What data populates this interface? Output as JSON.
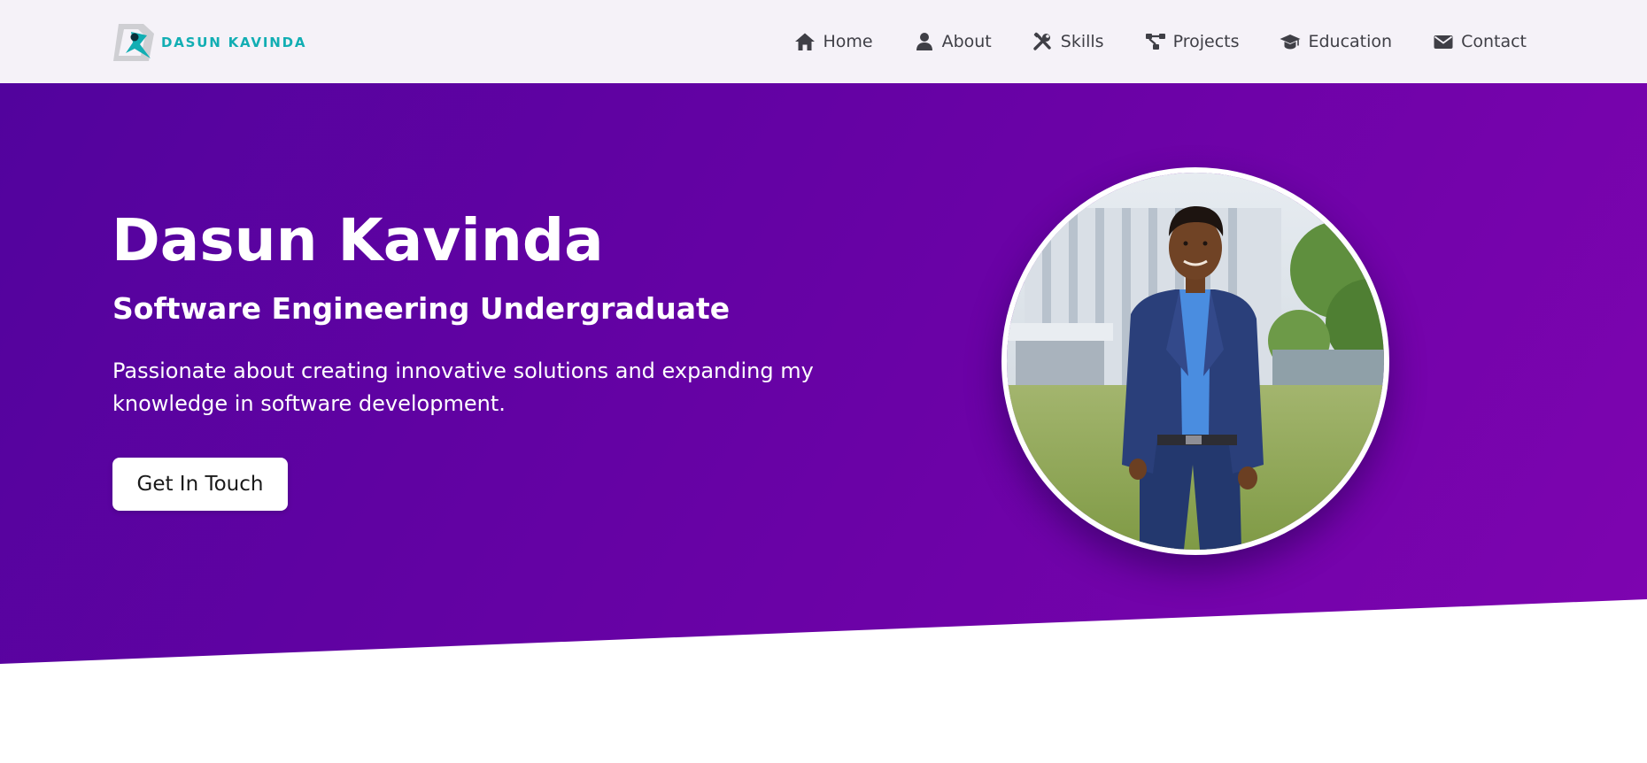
{
  "brand": {
    "name": "DASUN KAVINDA",
    "icon": "dk-logo-icon",
    "color": "#12aeb3"
  },
  "nav": {
    "items": [
      {
        "label": "Home",
        "icon": "home-icon"
      },
      {
        "label": "About",
        "icon": "user-icon"
      },
      {
        "label": "Skills",
        "icon": "tools-icon"
      },
      {
        "label": "Projects",
        "icon": "project-diagram-icon"
      },
      {
        "label": "Education",
        "icon": "graduation-cap-icon"
      },
      {
        "label": "Contact",
        "icon": "envelope-icon"
      }
    ]
  },
  "hero": {
    "name": "Dasun Kavinda",
    "subtitle": "Software Engineering Undergraduate",
    "description": "Passionate about creating innovative solutions and expanding my knowledge in software development.",
    "cta_label": "Get In Touch",
    "photo_alt": "Dasun Kavinda",
    "background_colors": [
      "#52039d",
      "#7e04b0"
    ]
  }
}
